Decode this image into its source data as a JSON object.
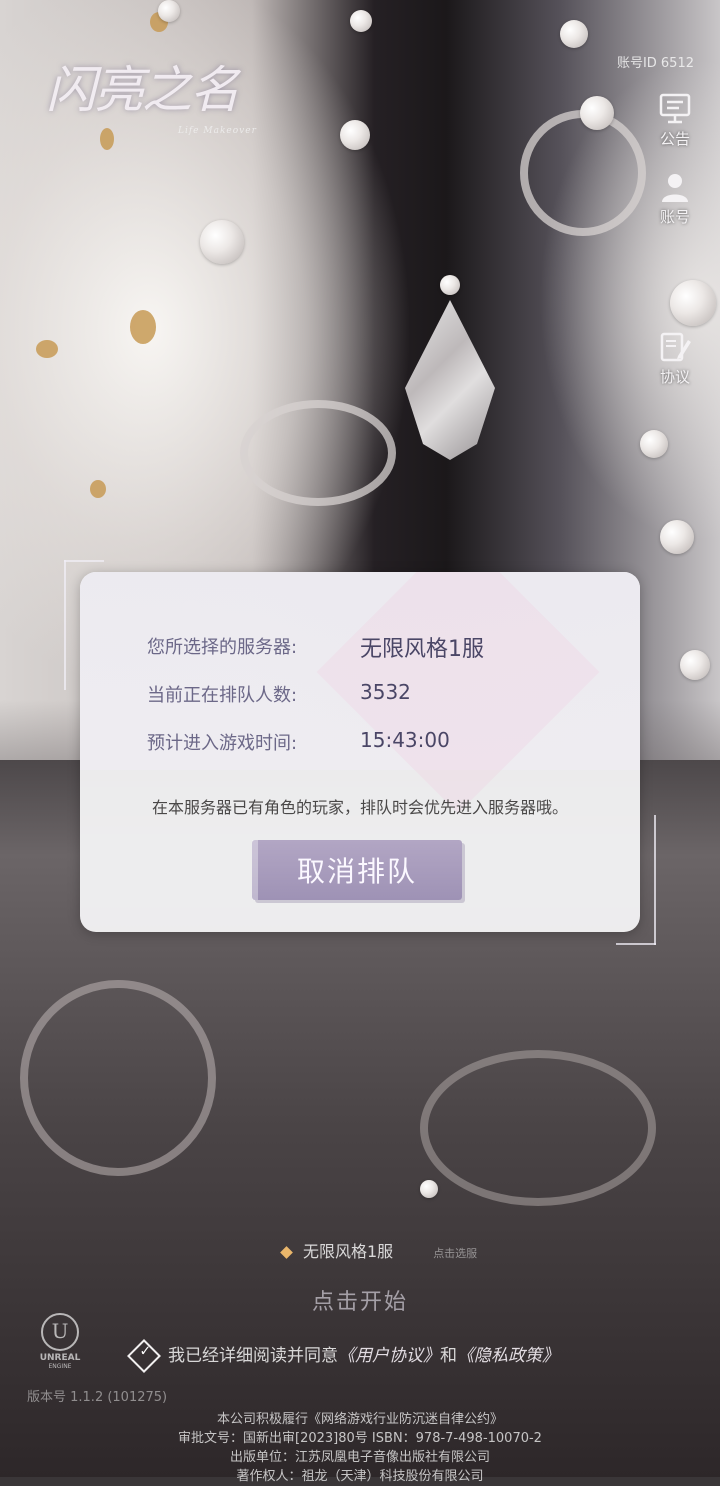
{
  "header": {
    "logo_title": "闪亮之名",
    "logo_subtitle": "Life Makeover",
    "account_id": "账号ID 6512"
  },
  "side_menu": {
    "items": [
      {
        "label": "公告",
        "icon": "announcement-icon"
      },
      {
        "label": "账号",
        "icon": "account-icon"
      },
      {
        "label": "协议",
        "icon": "agreement-icon"
      }
    ]
  },
  "queue_dialog": {
    "server_label": "您所选择的服务器:",
    "server_value": "无限风格1服",
    "queue_label": "当前正在排队人数:",
    "queue_value": "3532",
    "time_label": "预计进入游戏时间:",
    "time_value": "15:43:00",
    "notice": "在本服务器已有角色的玩家，排队时会优先进入服务器哦。",
    "cancel_label": "取消排队"
  },
  "bottom": {
    "server_name": "无限风格1服",
    "server_hint": "点击选服",
    "start_label": "点击开始",
    "agree_text": "我已经详细阅读并同意",
    "user_agreement": "《用户协议》",
    "and_text": "和",
    "privacy_policy": "《隐私政策》",
    "engine_name": "UNREAL",
    "engine_sub": "ENGINE",
    "version": "版本号 1.1.2 (101275)"
  },
  "footer": {
    "line1": "本公司积极履行《网络游戏行业防沉迷自律公约》",
    "line2": "审批文号：国新出审[2023]80号  ISBN：978-7-498-10070-2",
    "line3": "出版单位：江苏凤凰电子音像出版社有限公司",
    "line4": "著作权人：祖龙（天津）科技股份有限公司"
  },
  "colors": {
    "button_purple": "#a498bb",
    "dialog_bg": "#f6f5f8",
    "label_text": "#6c6888",
    "value_text": "#4a4666"
  }
}
